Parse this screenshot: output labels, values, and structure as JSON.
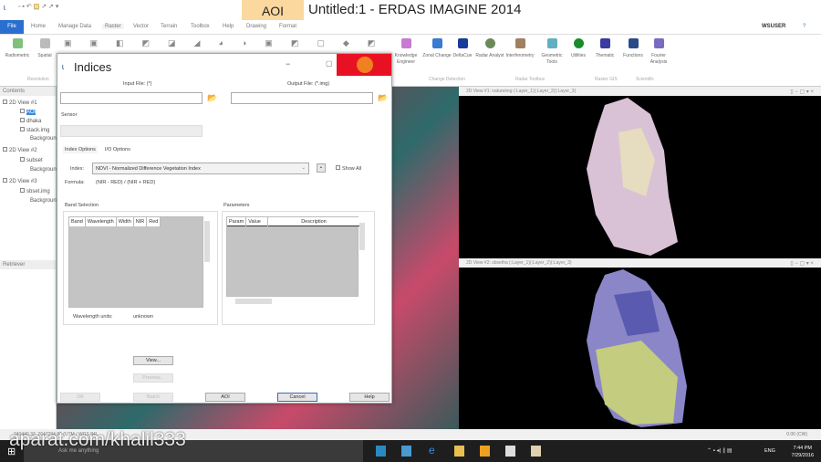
{
  "titlebar": {
    "context_tab": "AOI",
    "title": "Untitled:1 - ERDAS IMAGINE 2014",
    "user": "WSUSER"
  },
  "ribbon": {
    "file": "File",
    "tabs": [
      "Home",
      "Manage Data",
      "Raster",
      "Vector",
      "Terrain",
      "Toolbox",
      "Help",
      "Drawing",
      "Format"
    ],
    "buttons": [
      {
        "label": "Radiometric",
        "color": "#7fc07f"
      },
      {
        "label": "Spatial",
        "color": "#bbbbbb"
      },
      {
        "label": "Knowledge Engineer",
        "color": "#c87ad0"
      },
      {
        "label": "Zonal Change",
        "color": "#3a7ad0"
      },
      {
        "label": "DeltaCue",
        "color": "#1a3a9a"
      },
      {
        "label": "Radar Analyst",
        "color": "#6a8a5a"
      },
      {
        "label": "Interferometry",
        "color": "#a08060"
      },
      {
        "label": "Geometric Tools",
        "color": "#60b0c0"
      },
      {
        "label": "Utilities",
        "color": "#1a8a2a"
      },
      {
        "label": "Thematic",
        "color": "#3a3aa0"
      },
      {
        "label": "Functions",
        "color": "#2a4a8a"
      },
      {
        "label": "Fourier Analysis",
        "color": "#7a6ac0"
      }
    ],
    "groups": [
      "Resolution",
      "Change Detection",
      "Radar Toolbox",
      "Raster GIS",
      "Scientific"
    ]
  },
  "contents": {
    "header": "Contents",
    "items": [
      "2D View #1",
      "AOI",
      "dhaka",
      "stack.img",
      "Background",
      "2D View #2",
      "subset",
      "Background",
      "2D View #3",
      "sbset.img",
      "Background"
    ],
    "retriever": "Retriever"
  },
  "dialog": {
    "title": "Indices",
    "input_file_label": "Input File: (*)",
    "output_file_label": "Output File: (*.img)",
    "input_file": "",
    "output_file": "",
    "sensor_label": "Sensor",
    "sensor": "",
    "tabs": [
      "Index Options",
      "I/O Options"
    ],
    "index_label": "Index:",
    "index_value": "NDVI - Normalized Difference Vegetation Index",
    "show_all": "Show All",
    "formula_label": "Formula:",
    "formula": "(NIR - RED) / (NIR + RED)",
    "band_selection": "Band Selection",
    "band_columns": [
      "Band",
      "Wavelength",
      "Width",
      "NIR",
      "Red"
    ],
    "wavelength_units_label": "Wavelength units:",
    "wavelength_units": "unknown",
    "parameters": "Parameters",
    "param_columns": [
      "Param",
      "Value",
      "Description"
    ],
    "buttons": {
      "view": "View...",
      "preview": "Preview...",
      "ok": "OK",
      "batch": "Batch",
      "aoi": "AOI",
      "cancel": "Cancel",
      "help": "Help"
    }
  },
  "views": {
    "view1": "2D View #1: natureimg (:Layer_1)(:Layer_2)(:Layer_3)",
    "view2": "2D View #2: sbsetha (:Layer_1)(:Layer_2)(:Layer_3)"
  },
  "status": {
    "coords": "240440.32, 2647294.81  (UTM / WGS 84)",
    "scale": "0.00 (CW)"
  },
  "taskbar": {
    "search": "Ask me anything",
    "time": "7:44 PM",
    "date": "7/29/2016",
    "lang": "ENG"
  },
  "watermark": "aparat.com/khalil333"
}
